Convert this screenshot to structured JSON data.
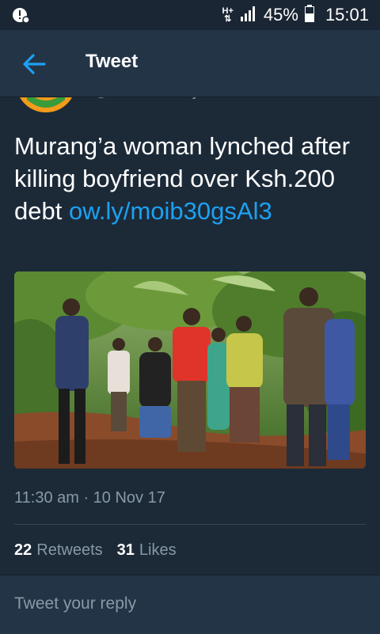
{
  "status_bar": {
    "network": "H+",
    "battery": "45%",
    "time": "15:01"
  },
  "app_bar": {
    "title": "Tweet",
    "back_icon": "arrow-left-icon"
  },
  "tweet": {
    "handle_partial": "@citizentvkenya",
    "text": "Murang’a woman lynched after killing boyfriend over Ksh.200 debt ",
    "link": "ow.ly/moib30gsAl3",
    "timestamp": "11:30 am · 10 Nov 17",
    "retweets_count": "22",
    "retweets_label": "Retweets",
    "likes_count": "31",
    "likes_label": "Likes"
  },
  "reply": {
    "placeholder": "Tweet your reply"
  },
  "colors": {
    "background": "#1c2a38",
    "app_bar": "#243447",
    "link": "#1da1f2",
    "secondary_text": "#8899a6"
  }
}
